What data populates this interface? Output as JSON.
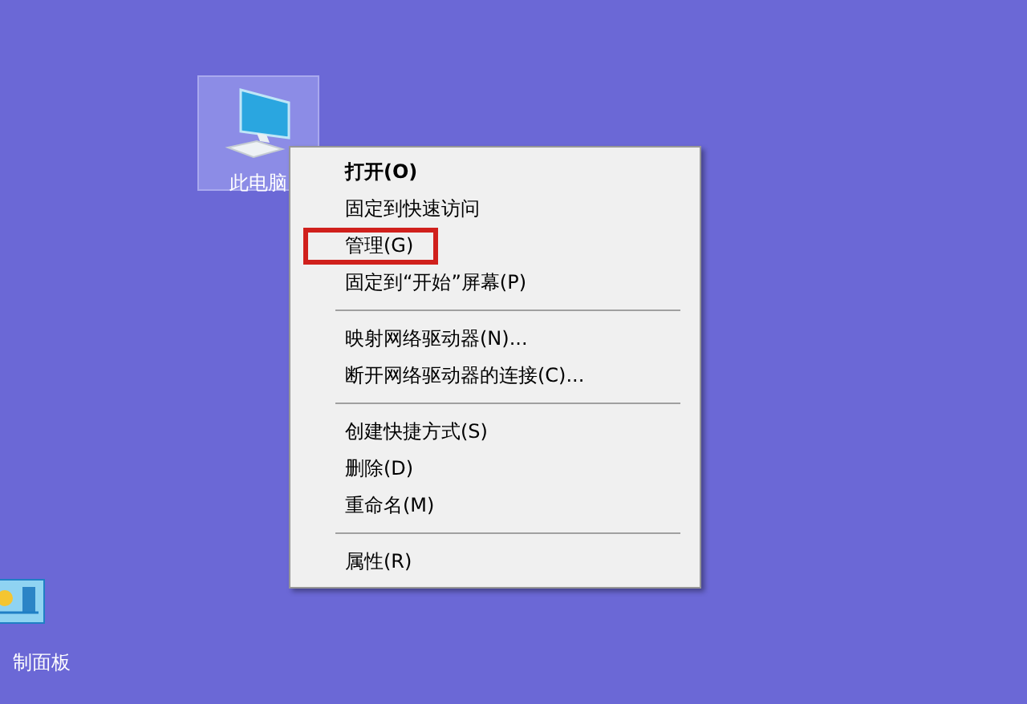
{
  "desktop_icons": [
    {
      "label": "此电脑",
      "kind": "computer",
      "selected": true
    },
    {
      "label": "制面板",
      "kind": "control-panel",
      "selected": false
    }
  ],
  "context_menu": {
    "groups": [
      [
        {
          "label": "打开(O)",
          "default": true,
          "highlighted": false
        },
        {
          "label": "固定到快速访问",
          "default": false,
          "highlighted": false
        },
        {
          "label": "管理(G)",
          "default": false,
          "highlighted": true
        },
        {
          "label": "固定到“开始”屏幕(P)",
          "default": false,
          "highlighted": false
        }
      ],
      [
        {
          "label": "映射网络驱动器(N)...",
          "default": false,
          "highlighted": false
        },
        {
          "label": "断开网络驱动器的连接(C)...",
          "default": false,
          "highlighted": false
        }
      ],
      [
        {
          "label": "创建快捷方式(S)",
          "default": false,
          "highlighted": false
        },
        {
          "label": "删除(D)",
          "default": false,
          "highlighted": false
        },
        {
          "label": "重命名(M)",
          "default": false,
          "highlighted": false
        }
      ],
      [
        {
          "label": "属性(R)",
          "default": false,
          "highlighted": false
        }
      ]
    ]
  }
}
